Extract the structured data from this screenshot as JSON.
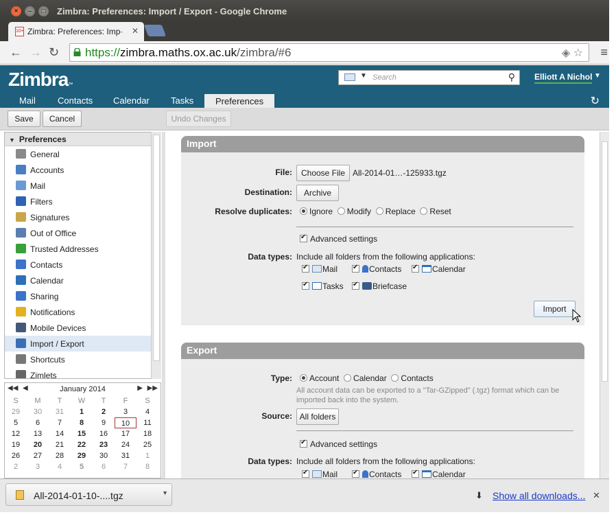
{
  "window": {
    "title": "Zimbra: Preferences: Import / Export - Google Chrome"
  },
  "browser": {
    "tab_title": "Zimbra: Preferences: Imp∙",
    "url_scheme": "https://",
    "url_host": "zimbra.maths.ox.ac.uk",
    "url_path": "/zimbra/#6"
  },
  "zimbra": {
    "logo": "Zimbra",
    "logo_tm": "™",
    "search_placeholder": "Search",
    "user": "Elliott A Nichol",
    "tabs": [
      "Mail",
      "Contacts",
      "Calendar",
      "Tasks",
      "Preferences"
    ],
    "active_tab": "Preferences"
  },
  "toolbar": {
    "save": "Save",
    "cancel": "Cancel",
    "undo": "Undo Changes"
  },
  "sidebar": {
    "header": "Preferences",
    "items": [
      {
        "label": "General",
        "color": "#8a8a8a"
      },
      {
        "label": "Accounts",
        "color": "#4a7fc1"
      },
      {
        "label": "Mail",
        "color": "#6b9ad3"
      },
      {
        "label": "Filters",
        "color": "#2f62b5"
      },
      {
        "label": "Signatures",
        "color": "#c9a64a"
      },
      {
        "label": "Out of Office",
        "color": "#5a7fb0"
      },
      {
        "label": "Trusted Addresses",
        "color": "#3aa03a"
      },
      {
        "label": "Contacts",
        "color": "#3b73c9"
      },
      {
        "label": "Calendar",
        "color": "#2f6fb6"
      },
      {
        "label": "Sharing",
        "color": "#3b73c9"
      },
      {
        "label": "Notifications",
        "color": "#e3b21e"
      },
      {
        "label": "Mobile Devices",
        "color": "#44597a"
      },
      {
        "label": "Import / Export",
        "color": "#3a6fb5"
      },
      {
        "label": "Shortcuts",
        "color": "#777777"
      },
      {
        "label": "Zimlets",
        "color": "#666666"
      }
    ],
    "selected": "Import / Export"
  },
  "calendar": {
    "month": "January 2014",
    "days_of_week": [
      "S",
      "M",
      "T",
      "W",
      "T",
      "F",
      "S"
    ],
    "weeks": [
      [
        "29",
        "30",
        "31",
        "1",
        "2",
        "3",
        "4"
      ],
      [
        "5",
        "6",
        "7",
        "8",
        "9",
        "10",
        "11"
      ],
      [
        "12",
        "13",
        "14",
        "15",
        "16",
        "17",
        "18"
      ],
      [
        "19",
        "20",
        "21",
        "22",
        "23",
        "24",
        "25"
      ],
      [
        "26",
        "27",
        "28",
        "29",
        "30",
        "31",
        "1"
      ],
      [
        "2",
        "3",
        "4",
        "5",
        "6",
        "7",
        "8"
      ]
    ],
    "today": "10"
  },
  "import": {
    "title": "Import",
    "file_label": "File:",
    "choose_file": "Choose File",
    "file_name": "All-2014-01…-125933.tgz",
    "destination_label": "Destination:",
    "destination_value": "Archive",
    "dup_label": "Resolve duplicates:",
    "dup_options": [
      "Ignore",
      "Modify",
      "Replace",
      "Reset"
    ],
    "advanced": "Advanced settings",
    "datatypes_label": "Data types:",
    "datatypes_desc": "Include all folders from the following applications:",
    "types": [
      "Mail",
      "Contacts",
      "Calendar",
      "Tasks",
      "Briefcase"
    ],
    "import_button": "Import"
  },
  "export": {
    "title": "Export",
    "type_label": "Type:",
    "type_options": [
      "Account",
      "Calendar",
      "Contacts"
    ],
    "hint": "All account data can be exported to a \"Tar-GZipped\" (.tgz) format which can be imported back into the system.",
    "source_label": "Source:",
    "source_value": "All folders",
    "advanced": "Advanced settings",
    "datatypes_label": "Data types:",
    "datatypes_desc": "Include all folders from the following applications:",
    "types": [
      "Mail",
      "Contacts",
      "Calendar"
    ]
  },
  "downloads": {
    "file": "All-2014-01-10-....tgz",
    "show_all": "Show all downloads..."
  }
}
